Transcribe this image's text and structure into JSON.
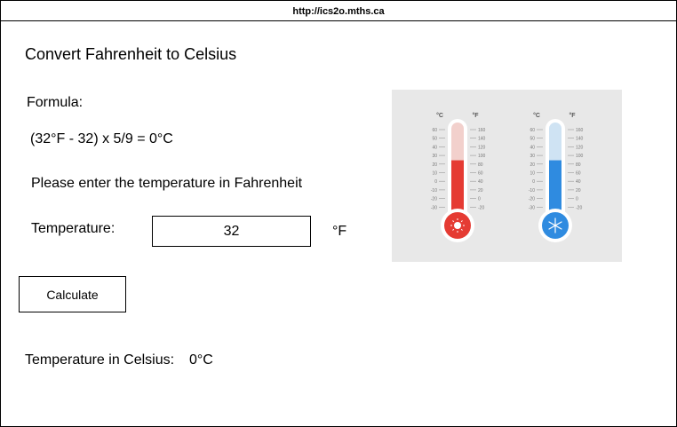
{
  "browser": {
    "url": "http://ics2o.mths.ca"
  },
  "page": {
    "title": "Convert Fahrenheit to Celsius",
    "formula_label": "Formula:",
    "formula": "(32°F - 32) x 5/9 = 0°C",
    "prompt": "Please enter the temperature in Fahrenheit"
  },
  "form": {
    "temperature_label": "Temperature:",
    "temperature_value": "32",
    "unit": "°F",
    "calculate_label": "Calculate"
  },
  "result": {
    "label": "Temperature in Celsius:",
    "value": "0°C"
  },
  "illustration": {
    "celsius_unit": "°C",
    "fahrenheit_unit": "°F",
    "celsius_ticks": [
      "60",
      "50",
      "40",
      "30",
      "20",
      "10",
      "0",
      "-10",
      "-20",
      "-30"
    ],
    "fahrenheit_ticks": [
      "160",
      "140",
      "120",
      "100",
      "80",
      "60",
      "40",
      "20",
      "0",
      "-20"
    ],
    "hot_color": "#e53b33",
    "cold_color": "#2f8be0",
    "hot_fill_fraction": 0.62,
    "cold_fill_fraction": 0.62
  }
}
